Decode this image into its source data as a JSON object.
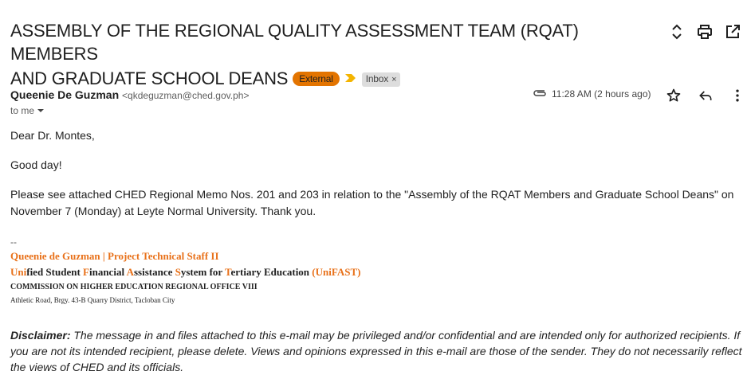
{
  "subject": {
    "line1": "ASSEMBLY OF THE REGIONAL QUALITY ASSESSMENT TEAM (RQAT) MEMBERS",
    "line2": "AND GRADUATE SCHOOL DEANS",
    "external_label": "External",
    "inbox_label": "Inbox",
    "inbox_remove": "×"
  },
  "sender": {
    "name": "Queenie De Guzman",
    "email": "<qkdeguzman@ched.gov.ph>",
    "to": "to me",
    "time": "11:28 AM (2 hours ago)"
  },
  "body": {
    "greeting": "Dear Dr. Montes,",
    "good_day": "Good day!",
    "message": "Please see attached CHED Regional Memo Nos. 201 and 203 in relation to the \"Assembly of the RQAT Members and Graduate School Deans\" on November 7 (Monday) at Leyte Normal University. Thank you."
  },
  "signature": {
    "dash": "--",
    "name_title": "Queenie de Guzman | Project Technical Staff II",
    "program_parts": [
      "Uni",
      "fied Student ",
      "F",
      "inancial ",
      "A",
      "ssistance ",
      "S",
      "ystem for ",
      "T",
      "ertiary Education ",
      "(UniFAST)"
    ],
    "office": "COMMISSION ON HIGHER EDUCATION REGIONAL OFFICE VIII",
    "address": "Athletic Road, Brgy. 43-B Quarry District, Tacloban City"
  },
  "disclaimer": {
    "label": "Disclaimer:",
    "text": " The message in and files attached to this e-mail may be privileged and/or confidential and are intended only for authorized recipients. If you are not its intended recipient, please delete. Views and opinions expressed in this e-mail are those of the sender. They do not necessarily reflect the views of CHED and its officials."
  },
  "icons": {
    "expand": "unfold-icon",
    "print": "print-icon",
    "popout": "open-in-new-icon",
    "attachment": "paperclip-icon",
    "star": "star-icon",
    "reply": "reply-icon",
    "more": "more-vert-icon",
    "importance": "importance-marker-icon",
    "dropdown": "dropdown-arrow-icon"
  },
  "colors": {
    "external_badge": "#e37400",
    "signature_orange": "#e8711a",
    "importance": "#f4b400",
    "inbox_badge": "#dddddd"
  }
}
